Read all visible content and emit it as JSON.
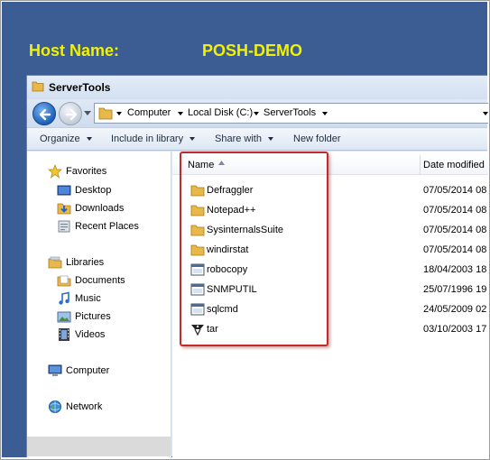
{
  "host": {
    "label": "Host Name:",
    "value": "POSH-DEMO"
  },
  "window": {
    "title": "ServerTools"
  },
  "address": {
    "crumbs": [
      "Computer",
      "Local Disk (C:)",
      "ServerTools"
    ]
  },
  "toolbar": {
    "organize": "Organize",
    "include": "Include in library",
    "share": "Share with",
    "new_folder": "New folder"
  },
  "nav": {
    "favorites": "Favorites",
    "desktop": "Desktop",
    "downloads": "Downloads",
    "recent": "Recent Places",
    "libraries": "Libraries",
    "documents": "Documents",
    "music": "Music",
    "pictures": "Pictures",
    "videos": "Videos",
    "computer": "Computer",
    "network": "Network"
  },
  "columns": {
    "name": "Name",
    "date": "Date modified"
  },
  "files": [
    {
      "name": "Defraggler",
      "date": "07/05/2014 08",
      "icon": "folder-icon"
    },
    {
      "name": "Notepad++",
      "date": "07/05/2014 08",
      "icon": "folder-icon"
    },
    {
      "name": "SysinternalsSuite",
      "date": "07/05/2014 08",
      "icon": "folder-icon"
    },
    {
      "name": "windirstat",
      "date": "07/05/2014 08",
      "icon": "folder-icon"
    },
    {
      "name": "robocopy",
      "date": "18/04/2003 18",
      "icon": "application-icon"
    },
    {
      "name": "SNMPUTIL",
      "date": "25/07/1996 19",
      "icon": "application-icon"
    },
    {
      "name": "sqlcmd",
      "date": "24/05/2009 02",
      "icon": "application-icon"
    },
    {
      "name": "tar",
      "date": "03/10/2003 17",
      "icon": "tar-application-icon"
    }
  ],
  "colors": {
    "desktop": "#3c5d93",
    "host_text": "#f2f200",
    "highlight": "#c32a2a"
  }
}
